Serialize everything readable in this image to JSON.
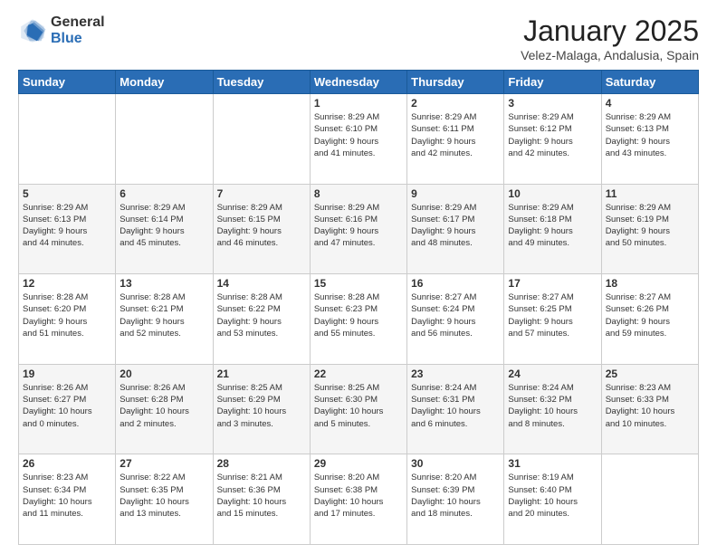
{
  "logo": {
    "general": "General",
    "blue": "Blue"
  },
  "title": {
    "month": "January 2025",
    "location": "Velez-Malaga, Andalusia, Spain"
  },
  "headers": [
    "Sunday",
    "Monday",
    "Tuesday",
    "Wednesday",
    "Thursday",
    "Friday",
    "Saturday"
  ],
  "weeks": [
    [
      {
        "day": "",
        "info": ""
      },
      {
        "day": "",
        "info": ""
      },
      {
        "day": "",
        "info": ""
      },
      {
        "day": "1",
        "info": "Sunrise: 8:29 AM\nSunset: 6:10 PM\nDaylight: 9 hours\nand 41 minutes."
      },
      {
        "day": "2",
        "info": "Sunrise: 8:29 AM\nSunset: 6:11 PM\nDaylight: 9 hours\nand 42 minutes."
      },
      {
        "day": "3",
        "info": "Sunrise: 8:29 AM\nSunset: 6:12 PM\nDaylight: 9 hours\nand 42 minutes."
      },
      {
        "day": "4",
        "info": "Sunrise: 8:29 AM\nSunset: 6:13 PM\nDaylight: 9 hours\nand 43 minutes."
      }
    ],
    [
      {
        "day": "5",
        "info": "Sunrise: 8:29 AM\nSunset: 6:13 PM\nDaylight: 9 hours\nand 44 minutes."
      },
      {
        "day": "6",
        "info": "Sunrise: 8:29 AM\nSunset: 6:14 PM\nDaylight: 9 hours\nand 45 minutes."
      },
      {
        "day": "7",
        "info": "Sunrise: 8:29 AM\nSunset: 6:15 PM\nDaylight: 9 hours\nand 46 minutes."
      },
      {
        "day": "8",
        "info": "Sunrise: 8:29 AM\nSunset: 6:16 PM\nDaylight: 9 hours\nand 47 minutes."
      },
      {
        "day": "9",
        "info": "Sunrise: 8:29 AM\nSunset: 6:17 PM\nDaylight: 9 hours\nand 48 minutes."
      },
      {
        "day": "10",
        "info": "Sunrise: 8:29 AM\nSunset: 6:18 PM\nDaylight: 9 hours\nand 49 minutes."
      },
      {
        "day": "11",
        "info": "Sunrise: 8:29 AM\nSunset: 6:19 PM\nDaylight: 9 hours\nand 50 minutes."
      }
    ],
    [
      {
        "day": "12",
        "info": "Sunrise: 8:28 AM\nSunset: 6:20 PM\nDaylight: 9 hours\nand 51 minutes."
      },
      {
        "day": "13",
        "info": "Sunrise: 8:28 AM\nSunset: 6:21 PM\nDaylight: 9 hours\nand 52 minutes."
      },
      {
        "day": "14",
        "info": "Sunrise: 8:28 AM\nSunset: 6:22 PM\nDaylight: 9 hours\nand 53 minutes."
      },
      {
        "day": "15",
        "info": "Sunrise: 8:28 AM\nSunset: 6:23 PM\nDaylight: 9 hours\nand 55 minutes."
      },
      {
        "day": "16",
        "info": "Sunrise: 8:27 AM\nSunset: 6:24 PM\nDaylight: 9 hours\nand 56 minutes."
      },
      {
        "day": "17",
        "info": "Sunrise: 8:27 AM\nSunset: 6:25 PM\nDaylight: 9 hours\nand 57 minutes."
      },
      {
        "day": "18",
        "info": "Sunrise: 8:27 AM\nSunset: 6:26 PM\nDaylight: 9 hours\nand 59 minutes."
      }
    ],
    [
      {
        "day": "19",
        "info": "Sunrise: 8:26 AM\nSunset: 6:27 PM\nDaylight: 10 hours\nand 0 minutes."
      },
      {
        "day": "20",
        "info": "Sunrise: 8:26 AM\nSunset: 6:28 PM\nDaylight: 10 hours\nand 2 minutes."
      },
      {
        "day": "21",
        "info": "Sunrise: 8:25 AM\nSunset: 6:29 PM\nDaylight: 10 hours\nand 3 minutes."
      },
      {
        "day": "22",
        "info": "Sunrise: 8:25 AM\nSunset: 6:30 PM\nDaylight: 10 hours\nand 5 minutes."
      },
      {
        "day": "23",
        "info": "Sunrise: 8:24 AM\nSunset: 6:31 PM\nDaylight: 10 hours\nand 6 minutes."
      },
      {
        "day": "24",
        "info": "Sunrise: 8:24 AM\nSunset: 6:32 PM\nDaylight: 10 hours\nand 8 minutes."
      },
      {
        "day": "25",
        "info": "Sunrise: 8:23 AM\nSunset: 6:33 PM\nDaylight: 10 hours\nand 10 minutes."
      }
    ],
    [
      {
        "day": "26",
        "info": "Sunrise: 8:23 AM\nSunset: 6:34 PM\nDaylight: 10 hours\nand 11 minutes."
      },
      {
        "day": "27",
        "info": "Sunrise: 8:22 AM\nSunset: 6:35 PM\nDaylight: 10 hours\nand 13 minutes."
      },
      {
        "day": "28",
        "info": "Sunrise: 8:21 AM\nSunset: 6:36 PM\nDaylight: 10 hours\nand 15 minutes."
      },
      {
        "day": "29",
        "info": "Sunrise: 8:20 AM\nSunset: 6:38 PM\nDaylight: 10 hours\nand 17 minutes."
      },
      {
        "day": "30",
        "info": "Sunrise: 8:20 AM\nSunset: 6:39 PM\nDaylight: 10 hours\nand 18 minutes."
      },
      {
        "day": "31",
        "info": "Sunrise: 8:19 AM\nSunset: 6:40 PM\nDaylight: 10 hours\nand 20 minutes."
      },
      {
        "day": "",
        "info": ""
      }
    ]
  ]
}
